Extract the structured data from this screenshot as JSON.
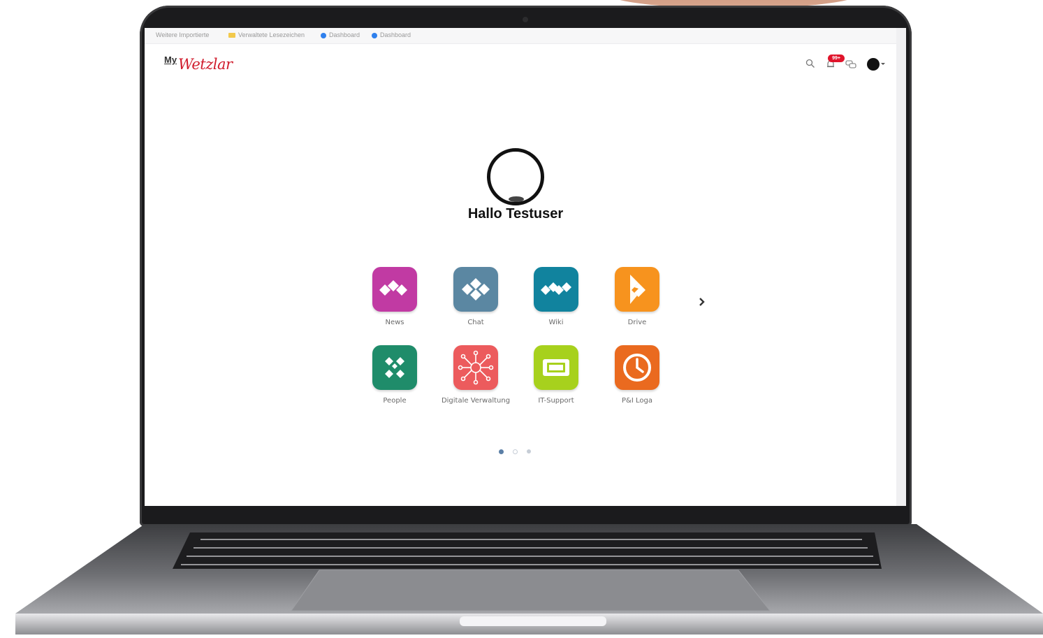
{
  "bookmarks_bar": {
    "items": [
      {
        "label": "Weitere Importierte",
        "icon": "text"
      },
      {
        "label": "Verwaltete Lesezeichen",
        "icon": "folder-icon"
      },
      {
        "label": "Dashboard",
        "icon": "site-icon"
      },
      {
        "label": "Dashboard",
        "icon": "site-icon"
      }
    ]
  },
  "brand": {
    "prefix": "My",
    "name": "Wetzlar",
    "color": "#d01c2c"
  },
  "header": {
    "notification_badge": "99+",
    "icons": [
      "search-icon",
      "notification-icon",
      "chat-icon",
      "avatar",
      "chevron-down-icon"
    ]
  },
  "profile": {
    "greeting": "Hallo Testuser"
  },
  "apps": [
    {
      "label": "News",
      "icon": "news-icon",
      "color": "#c13aa3"
    },
    {
      "label": "Chat",
      "icon": "chat-app-icon",
      "color": "#5b87a2"
    },
    {
      "label": "Wiki",
      "icon": "wiki-icon",
      "color": "#11839e"
    },
    {
      "label": "Drive",
      "icon": "drive-icon",
      "color": "#f7931e"
    },
    {
      "label": "People",
      "icon": "people-icon",
      "color": "#1f8c6a"
    },
    {
      "label": "Digitale Verwaltung",
      "icon": "network-icon",
      "color": "#ec5b5d"
    },
    {
      "label": "IT-Support",
      "icon": "ticket-icon",
      "color": "#a7d11d"
    },
    {
      "label": "P&I Loga",
      "icon": "clock-icon",
      "color": "#ea6a1f"
    }
  ],
  "carousel": {
    "pages": 3,
    "active_page": 1,
    "next_icon": "chevron-right-icon"
  }
}
